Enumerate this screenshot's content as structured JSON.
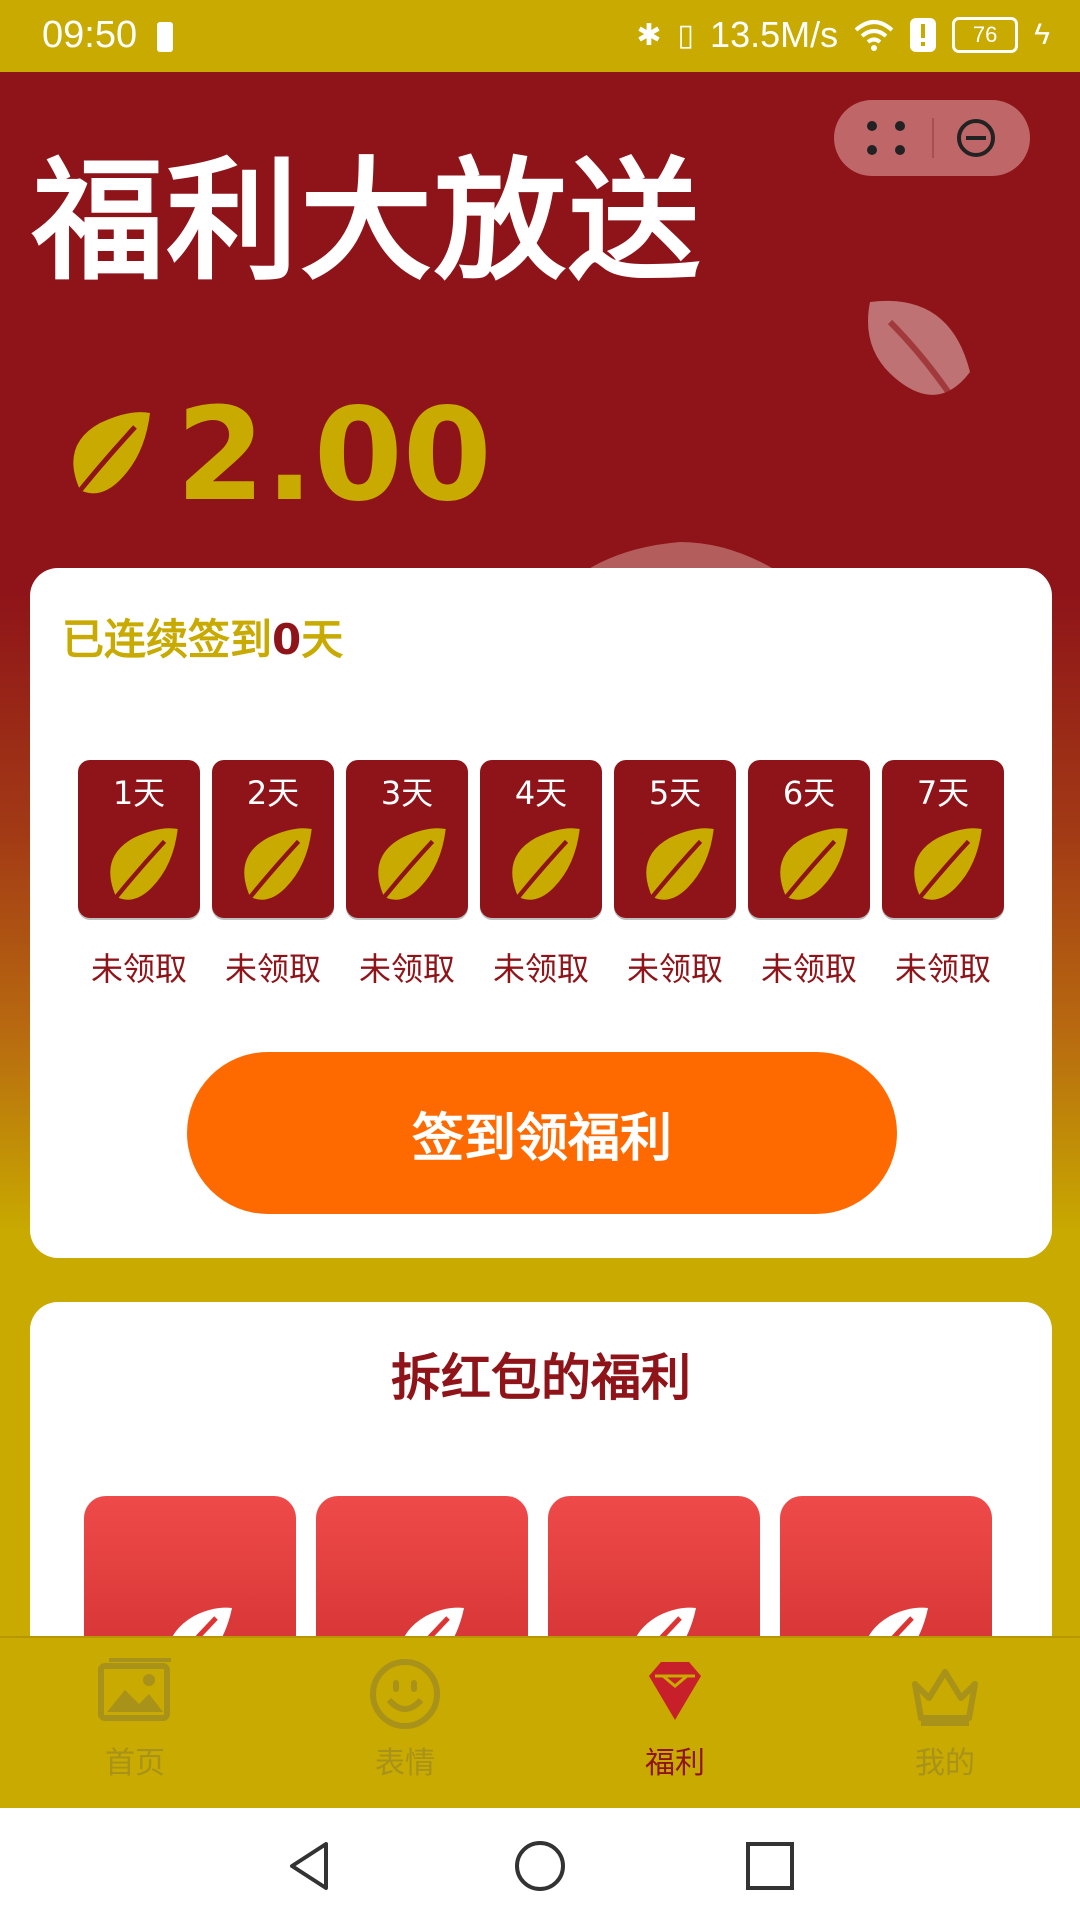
{
  "status_bar": {
    "time": "09:50",
    "network_speed": "13.5M/s",
    "battery": "76"
  },
  "header": {
    "title": "福利大放送",
    "balance": "2.00"
  },
  "signin": {
    "streak_prefix": "已连续签到",
    "streak_days": "0",
    "streak_suffix": "天",
    "days": [
      {
        "label": "1天",
        "status": "未领取"
      },
      {
        "label": "2天",
        "status": "未领取"
      },
      {
        "label": "3天",
        "status": "未领取"
      },
      {
        "label": "4天",
        "status": "未领取"
      },
      {
        "label": "5天",
        "status": "未领取"
      },
      {
        "label": "6天",
        "status": "未领取"
      },
      {
        "label": "7天",
        "status": "未领取"
      }
    ],
    "button_label": "签到领福利"
  },
  "red_packets": {
    "title": "拆红包的福利"
  },
  "bottom_nav": {
    "items": [
      {
        "label": "首页",
        "icon": "gallery-icon"
      },
      {
        "label": "表情",
        "icon": "smiley-icon"
      },
      {
        "label": "福利",
        "icon": "gem-icon"
      },
      {
        "label": "我的",
        "icon": "crown-icon"
      }
    ],
    "active_index": 2
  },
  "colors": {
    "primary_red": "#8f1419",
    "gold": "#c8aa00",
    "button_orange": "#ff6a00"
  }
}
